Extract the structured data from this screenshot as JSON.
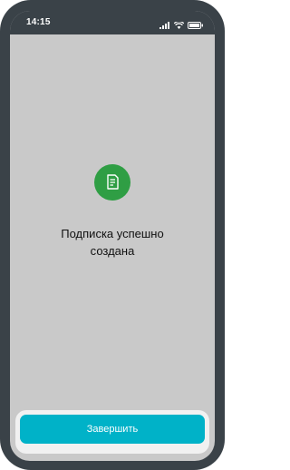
{
  "status_bar": {
    "time": "14:15",
    "icons": [
      "signal-icon",
      "wifi-icon",
      "battery-icon"
    ]
  },
  "content": {
    "icon": "document-icon",
    "message_line1": "Подписка успешно",
    "message_line2": "создана"
  },
  "footer": {
    "finish_label": "Завершить"
  },
  "colors": {
    "frame": "#3a4248",
    "screen_background": "#c9c9c9",
    "success": "#2f9e44",
    "accent": "#00b2c8"
  }
}
